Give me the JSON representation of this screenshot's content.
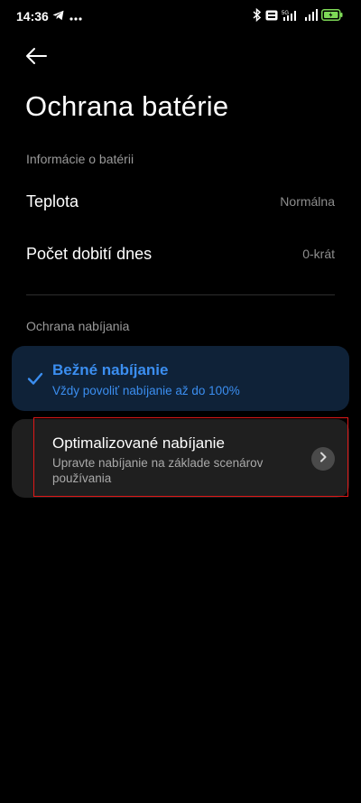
{
  "status_bar": {
    "time": "14:36",
    "left_icons": [
      "telegram-icon",
      "more-dots-icon"
    ],
    "right_icons": [
      "bluetooth-icon",
      "vowifi-icon",
      "5g-signal-icon",
      "signal-icon",
      "battery-charging-icon"
    ],
    "network_label": "5G",
    "battery_color": "#7ed957"
  },
  "header": {
    "back_icon": "arrow-left-icon",
    "title": "Ochrana batérie"
  },
  "battery_info": {
    "section_label": "Informácie o batérii",
    "rows": [
      {
        "label": "Teplota",
        "value": "Normálna"
      },
      {
        "label": "Počet dobití dnes",
        "value": "0-krát"
      }
    ]
  },
  "charging_protection": {
    "section_label": "Ochrana nabíjania",
    "options": [
      {
        "title": "Bežné nabíjanie",
        "subtitle": "Vždy povoliť nabíjanie až do 100%",
        "selected": true
      },
      {
        "title": "Optimalizované nabíjanie",
        "subtitle": "Upravte nabíjanie na základe scenárov používania",
        "selected": false
      }
    ]
  },
  "colors": {
    "accent": "#3b8ef0",
    "selected_card_bg": "#0f2238",
    "card_bg": "#1f1f1f",
    "highlight": "#e01818"
  }
}
